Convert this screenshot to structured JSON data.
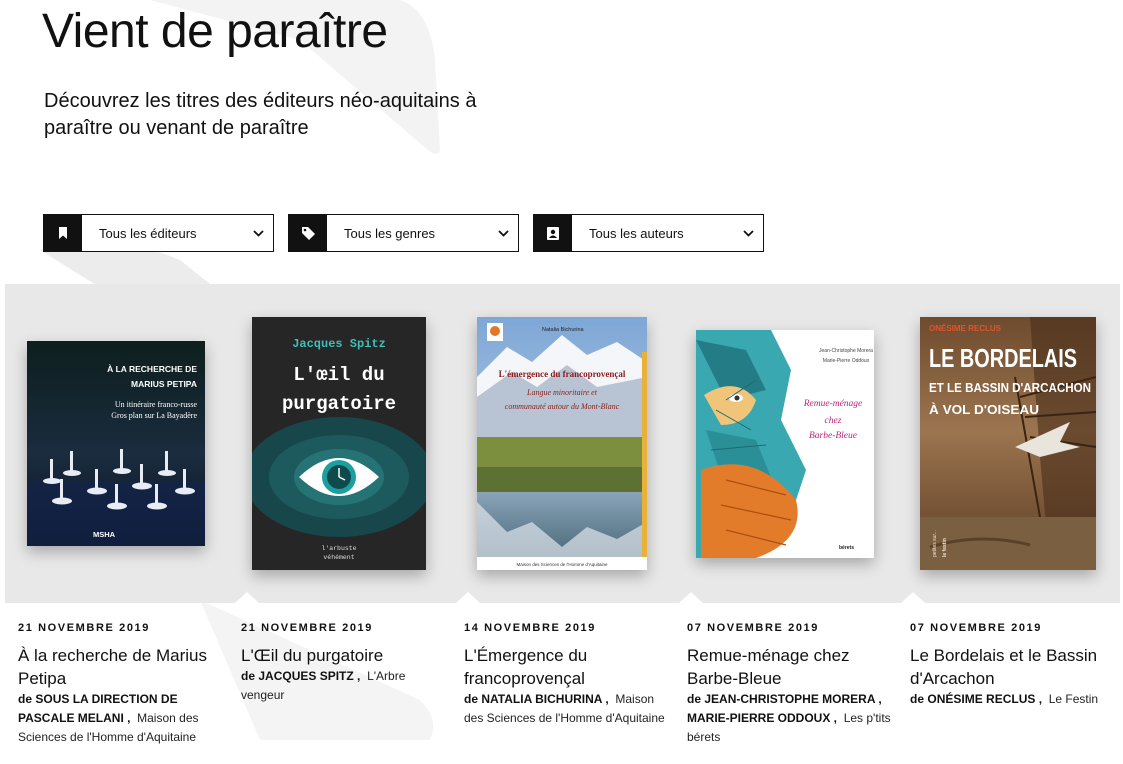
{
  "page": {
    "title": "Vient de paraître",
    "subtitle": "Découvrez les titres des éditeurs néo-aquitains à paraître ou venant de paraître"
  },
  "filters": [
    {
      "label": "Tous les éditeurs",
      "icon": "bookmark-icon"
    },
    {
      "label": "Tous les genres",
      "icon": "tag-icon"
    },
    {
      "label": "Tous les auteurs",
      "icon": "contact-card-icon"
    }
  ],
  "colors": {
    "accent": "#111111",
    "shelf": "#e8e8e8"
  },
  "books": [
    {
      "date": "21 NOVEMBRE 2019",
      "title": "À la recherche de Marius Petipa",
      "by": "de",
      "authors": "SOUS LA DIRECTION DE PASCALE MELANI",
      "publisher": "Maison des Sciences de l'Homme d'Aquitaine",
      "cover": {
        "line1": "À LA RECHERCHE DE",
        "line2": "MARIUS PETIPA",
        "line3": "Un itinéraire franco-russe",
        "line4": "Gros plan sur La Bayadère",
        "mark": "MSHA"
      }
    },
    {
      "date": "21 NOVEMBRE 2019",
      "title": "L'Œil du purgatoire",
      "by": "de",
      "authors": "JACQUES SPITZ",
      "publisher": "L'Arbre vengeur",
      "cover": {
        "author": "Jacques Spitz",
        "line1": "L'œil du",
        "line2": "purgatoire",
        "mark1": "l'arbuste",
        "mark2": "véhément"
      }
    },
    {
      "date": "14 NOVEMBRE 2019",
      "title": "L'Émergence du francoprovençal",
      "by": "de",
      "authors": "NATALIA BICHURINA",
      "publisher": "Maison des Sciences de l'Homme d'Aquitaine",
      "cover": {
        "author": "Natalia Bichurina",
        "line1": "L'émergence du francoprovençal",
        "line2": "Langue minoritaire et",
        "line3": "communauté autour du Mont-Blanc",
        "footer": "Maison des Sciences de l'Homme d'Aquitaine"
      }
    },
    {
      "date": "07 NOVEMBRE 2019",
      "title": "Remue-ménage chez Barbe-Bleue",
      "by": "de",
      "authors": "JEAN-CHRISTOPHE MORERA , MARIE-PIERRE ODDOUX",
      "publisher": "Les p'tits bérets",
      "cover": {
        "author1": "Jean-Christophe Morera",
        "author2": "Marie-Pierre Oddoux",
        "line1": "Remue-ménage",
        "line2": "chez",
        "line3": "Barbe-Bleue",
        "mark": "bérets"
      }
    },
    {
      "date": "07 NOVEMBRE 2019",
      "title": "Le Bordelais et le Bassin d'Arcachon",
      "by": "de",
      "authors": "ONÉSIME RECLUS",
      "publisher": "Le Festin",
      "cover": {
        "author": "ONÉSIME RECLUS",
        "line1": "LE BORDELAIS",
        "line2": "ET LE BASSIN D'ARCACHON",
        "line3": "À VOL D'OISEAU",
        "side": "petites sur...",
        "mark": "le festin"
      }
    }
  ]
}
